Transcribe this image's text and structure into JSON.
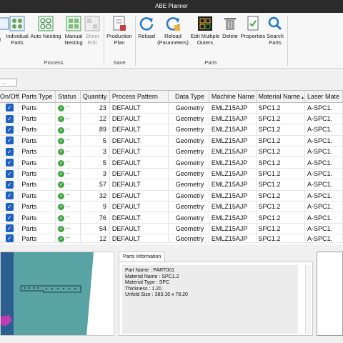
{
  "window": {
    "title": "ABE Planner"
  },
  "ribbon": {
    "buttons": {
      "partial_clip": "g",
      "individual_parts": "Individual\nParts",
      "auto_nesting": "Auto Nesting",
      "manual_nesting": "Manual\nNesting",
      "sheet_edit": "Sheet\nEdit",
      "production_plan": "Production\nPlan",
      "reload": "Reload",
      "reload_parameters": "Reload\n(Parameters)",
      "edit_multiple_outers": "Edit Multiple\nOuters",
      "delete": "Delete",
      "properties": "Properties",
      "search_parts": "Search\nParts"
    },
    "groups": {
      "process": "Process",
      "save": "Save",
      "parts": "Parts"
    }
  },
  "filter": {
    "value": "..."
  },
  "grid": {
    "columns": [
      "On/Off",
      "Parts Type",
      "Status",
      "Quantity",
      "Process Pattern",
      "Data Type",
      "Machine Name",
      "Material Name",
      "Laser Mate"
    ],
    "sort_indicator": "▲",
    "status_text": "⁼⁼",
    "rows": [
      {
        "parts_type": "Parts",
        "quantity": "23",
        "pattern": "DEFAULT",
        "data_type": "Geometry",
        "machine": "EMLZ15AJP",
        "material": "SPC1.2",
        "laser": "A-SPC1."
      },
      {
        "parts_type": "Parts",
        "quantity": "12",
        "pattern": "DEFAULT",
        "data_type": "Geometry",
        "machine": "EMLZ15AJP",
        "material": "SPC1.2",
        "laser": "A-SPC1."
      },
      {
        "parts_type": "Parts",
        "quantity": "89",
        "pattern": "DEFAULT",
        "data_type": "Geometry",
        "machine": "EMLZ15AJP",
        "material": "SPC1.2",
        "laser": "A-SPC1."
      },
      {
        "parts_type": "Parts",
        "quantity": "5",
        "pattern": "DEFAULT",
        "data_type": "Geometry",
        "machine": "EMLZ15AJP",
        "material": "SPC1.2",
        "laser": "A-SPC1."
      },
      {
        "parts_type": "Parts",
        "quantity": "3",
        "pattern": "DEFAULT",
        "data_type": "Geometry",
        "machine": "EMLZ15AJP",
        "material": "SPC1.2",
        "laser": "A-SPC1."
      },
      {
        "parts_type": "Parts",
        "quantity": "5",
        "pattern": "DEFAULT",
        "data_type": "Geometry",
        "machine": "EMLZ15AJP",
        "material": "SPC1.2",
        "laser": "A-SPC1."
      },
      {
        "parts_type": "Parts",
        "quantity": "3",
        "pattern": "DEFAULT",
        "data_type": "Geometry",
        "machine": "EMLZ15AJP",
        "material": "SPC1.2",
        "laser": "A-SPC1."
      },
      {
        "parts_type": "Parts",
        "quantity": "57",
        "pattern": "DEFAULT",
        "data_type": "Geometry",
        "machine": "EMLZ15AJP",
        "material": "SPC1.2",
        "laser": "A-SPC1."
      },
      {
        "parts_type": "Parts",
        "quantity": "32",
        "pattern": "DEFAULT",
        "data_type": "Geometry",
        "machine": "EMLZ15AJP",
        "material": "SPC1.2",
        "laser": "A-SPC1."
      },
      {
        "parts_type": "Parts",
        "quantity": "9",
        "pattern": "DEFAULT",
        "data_type": "Geometry",
        "machine": "EMLZ15AJP",
        "material": "SPC1.2",
        "laser": "A-SPC1."
      },
      {
        "parts_type": "Parts",
        "quantity": "76",
        "pattern": "DEFAULT",
        "data_type": "Geometry",
        "machine": "EMLZ15AJP",
        "material": "SPC1.2",
        "laser": "A-SPC1."
      },
      {
        "parts_type": "Parts",
        "quantity": "54",
        "pattern": "DEFAULT",
        "data_type": "Geometry",
        "machine": "EMLZ15AJP",
        "material": "SPC1.2",
        "laser": "A-SPC1."
      },
      {
        "parts_type": "Parts",
        "quantity": "12",
        "pattern": "DEFAULT",
        "data_type": "Geometry",
        "machine": "EMLZ15AJP",
        "material": "SPC1.2",
        "laser": "A-SPC1."
      }
    ]
  },
  "info": {
    "tab": "Parts Information",
    "lines": [
      "Part Name : PART001",
      "Material Name : SPC1.2",
      "Material Type : SPC",
      "Thickness : 1.20",
      "Unfold Size : 383.16 x 78.20"
    ]
  },
  "colors": {
    "checkbox": "#1c61c4",
    "status_ok": "#3fa83f",
    "titlebar": "#2b2b2b",
    "preview_bg": "#4a9a9a"
  }
}
